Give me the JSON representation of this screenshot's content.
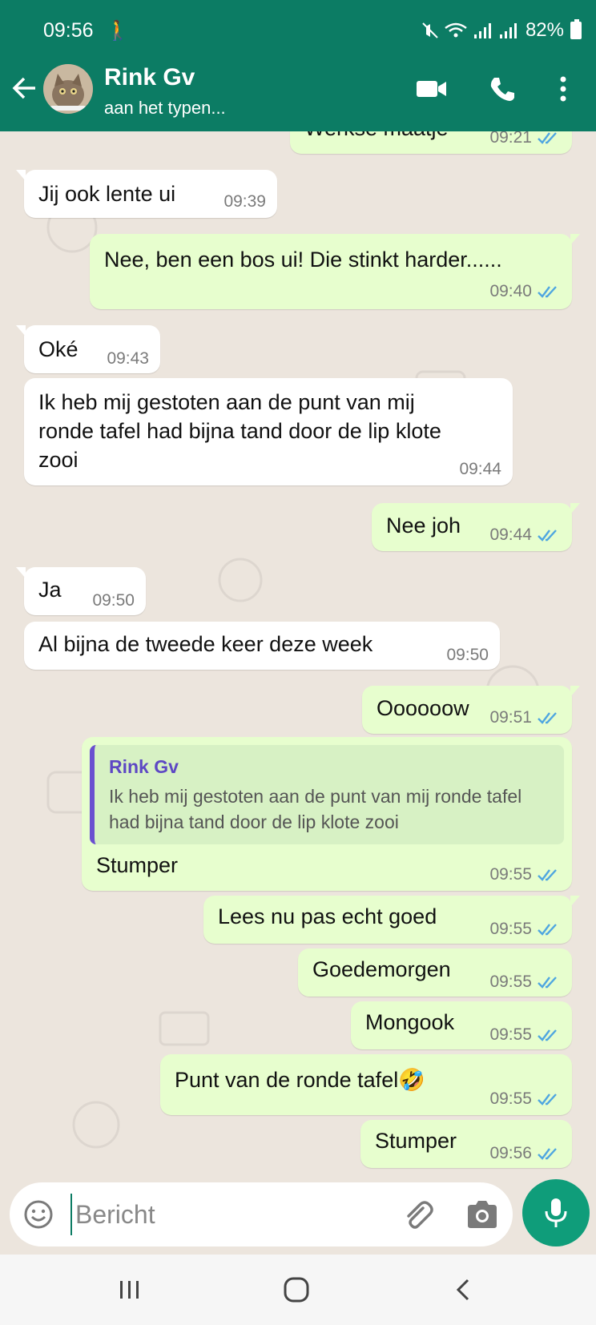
{
  "statusbar": {
    "time": "09:56",
    "battery": "82%"
  },
  "header": {
    "contact_name": "Rink Gv",
    "contact_status": "aan het typen..."
  },
  "messages": [
    {
      "dir": "out",
      "text": "Werkse maatje",
      "time": "09:21",
      "ticks": true
    },
    {
      "dir": "in",
      "text": "Jij ook lente ui",
      "time": "09:39"
    },
    {
      "dir": "out",
      "text": "Nee, ben een bos ui! Die stinkt harder......",
      "time": "09:40",
      "ticks": true
    },
    {
      "dir": "in",
      "text": "Oké",
      "time": "09:43"
    },
    {
      "dir": "in",
      "text": "Ik heb mij gestoten aan de punt van mij ronde tafel had bijna tand door de lip klote zooi",
      "time": "09:44"
    },
    {
      "dir": "out",
      "text": "Nee joh",
      "time": "09:44",
      "ticks": true
    },
    {
      "dir": "in",
      "text": "Ja",
      "time": "09:50"
    },
    {
      "dir": "in",
      "text": "Al bijna de tweede keer deze week",
      "time": "09:50"
    },
    {
      "dir": "out",
      "text": "Oooooow",
      "time": "09:51",
      "ticks": true
    },
    {
      "dir": "out",
      "text": "Stumper",
      "time": "09:55",
      "ticks": true,
      "quote": {
        "name": "Rink Gv",
        "text": "Ik heb mij gestoten aan de punt van mij ronde tafel had bijna tand door de lip klote zooi"
      }
    },
    {
      "dir": "out",
      "text": "Lees nu pas echt goed",
      "time": "09:55",
      "ticks": true
    },
    {
      "dir": "out",
      "text": "Goedemorgen",
      "time": "09:55",
      "ticks": true
    },
    {
      "dir": "out",
      "text": "Mongook",
      "time": "09:55",
      "ticks": true
    },
    {
      "dir": "out",
      "text": "Punt van de ronde tafel",
      "emoji": "🤣",
      "time": "09:55",
      "ticks": true
    },
    {
      "dir": "out",
      "text": "Stumper",
      "time": "09:56",
      "ticks": true
    }
  ],
  "input": {
    "placeholder": "Bericht"
  },
  "colors": {
    "header": "#0c7c64",
    "outgoing": "#e7fece",
    "incoming": "#ffffff",
    "ticks": "#4fa6e0",
    "mic": "#0f9d7a"
  }
}
